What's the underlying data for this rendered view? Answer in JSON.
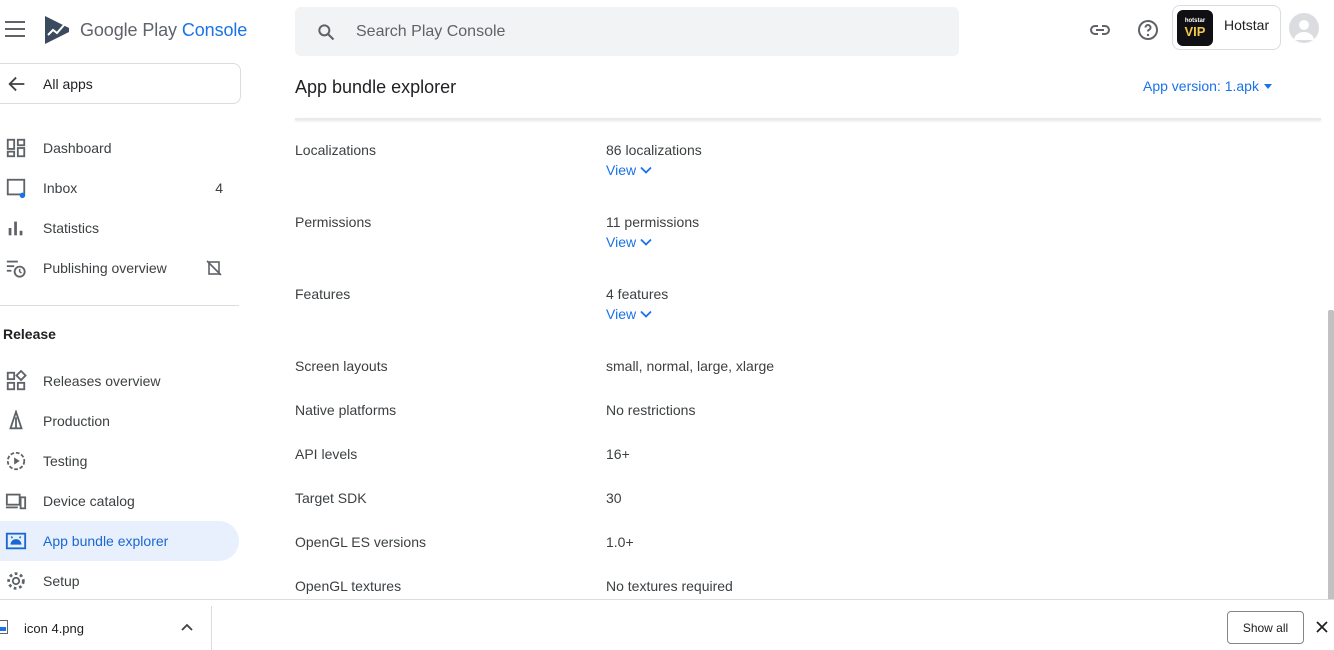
{
  "header": {
    "logo_text_main": "Google Play",
    "logo_text_accent": "Console",
    "search_placeholder": "Search Play Console",
    "app_icon_line1": "hotstar",
    "app_icon_line2": "VIP",
    "app_name": "Hotstar"
  },
  "sidebar": {
    "all_apps": "All apps",
    "items": [
      {
        "label": "Dashboard",
        "icon": "dashboard-icon"
      },
      {
        "label": "Inbox",
        "icon": "inbox-icon",
        "count": "4"
      },
      {
        "label": "Statistics",
        "icon": "statistics-icon"
      },
      {
        "label": "Publishing overview",
        "icon": "publishing-overview-icon"
      }
    ],
    "section_title": "Release",
    "release_items": [
      {
        "label": "Releases overview",
        "icon": "releases-overview-icon"
      },
      {
        "label": "Production",
        "icon": "production-icon"
      },
      {
        "label": "Testing",
        "icon": "testing-icon"
      },
      {
        "label": "Device catalog",
        "icon": "device-catalog-icon"
      },
      {
        "label": "App bundle explorer",
        "icon": "app-bundle-explorer-icon",
        "active": true
      },
      {
        "label": "Setup",
        "icon": "setup-gear-icon"
      }
    ]
  },
  "main": {
    "title": "App bundle explorer",
    "version_label": "App version: 1.apk",
    "rows": [
      {
        "label": "Localizations",
        "value": "86 localizations",
        "link": "View"
      },
      {
        "label": "Permissions",
        "value": "11 permissions",
        "link": "View"
      },
      {
        "label": "Features",
        "value": "4 features",
        "link": "View"
      },
      {
        "label": "Screen layouts",
        "value": "small, normal, large, xlarge"
      },
      {
        "label": "Native platforms",
        "value": "No restrictions"
      },
      {
        "label": "API levels",
        "value": "16+"
      },
      {
        "label": "Target SDK",
        "value": "30"
      },
      {
        "label": "OpenGL ES versions",
        "value": "1.0+"
      },
      {
        "label": "OpenGL textures",
        "value": "No textures required"
      }
    ]
  },
  "download_bar": {
    "file_name": "icon 4.png",
    "show_all": "Show all"
  },
  "colors": {
    "accent": "#1a73e8",
    "active_bg": "#e8f0fe",
    "active_text": "#1967d2"
  }
}
